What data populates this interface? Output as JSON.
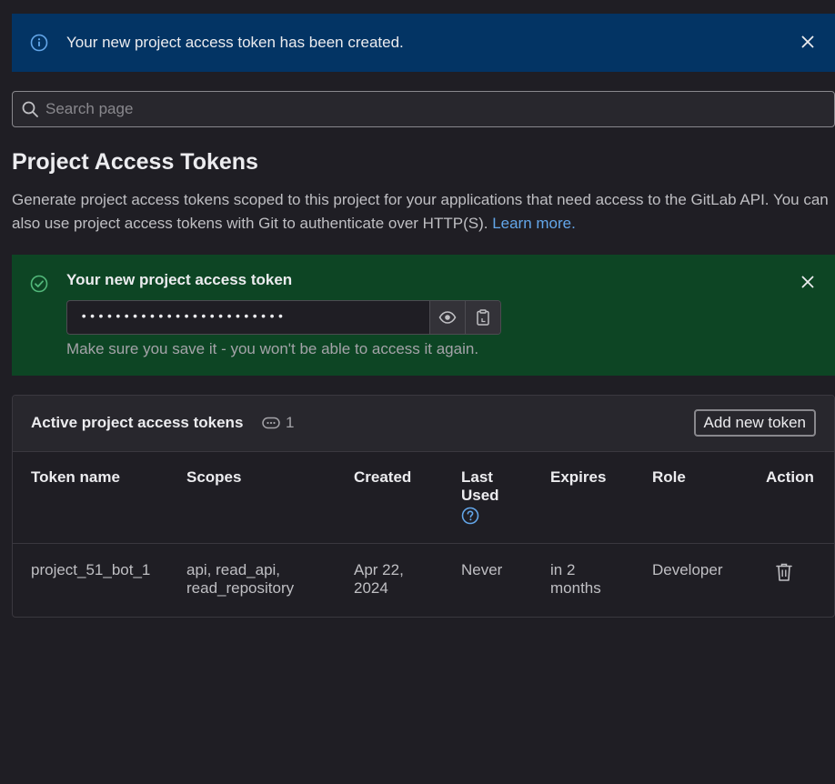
{
  "alert": {
    "message": "Your new project access token has been created.",
    "close_label": "Dismiss",
    "color": "#033464"
  },
  "search": {
    "placeholder": "Search page"
  },
  "page": {
    "title": "Project Access Tokens",
    "description": "Generate project access tokens scoped to this project for your applications that need access to the GitLab API. You can also use project access tokens with Git to authenticate over HTTP(S).",
    "learn_more": "Learn more."
  },
  "new_token": {
    "title": "Your new project access token",
    "masked_value": "••••••••••••••••••••••••",
    "note": "Make sure you save it - you won't be able to access it again.",
    "reveal_icon": "eye-icon",
    "copy_icon": "copy-to-clipboard-icon",
    "color": "#0d4524"
  },
  "active_tokens": {
    "title": "Active project access tokens",
    "count": "1",
    "count_icon": "token-icon",
    "add_button": "Add new token",
    "columns": {
      "name": "Token name",
      "scopes": "Scopes",
      "created": "Created",
      "last_used_1": "Last",
      "last_used_2": "Used",
      "expires": "Expires",
      "role": "Role",
      "action": "Action"
    },
    "rows": [
      {
        "name": "project_51_bot_1",
        "scopes_1": "api, read_api,",
        "scopes_2": "read_repository",
        "created_1": "Apr 22,",
        "created_2": "2024",
        "last_used": "Never",
        "expires_1": "in 2",
        "expires_2": "months",
        "role": "Developer",
        "action_icon": "trash-icon"
      }
    ]
  },
  "colors": {
    "background": "#1f1e24",
    "link": "#63a6e9",
    "text": "#ececef",
    "muted": "#bfbfc3"
  }
}
